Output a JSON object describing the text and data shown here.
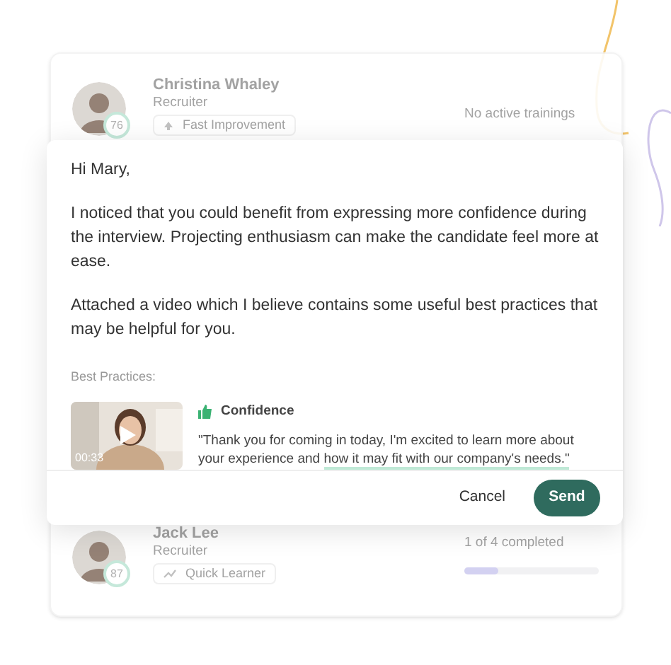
{
  "people": [
    {
      "name": "Christina Whaley",
      "role": "Recruiter",
      "score": "76",
      "tag": {
        "kind": "arrow",
        "label": "Fast Improvement"
      },
      "status": {
        "kind": "text",
        "label": "No active trainings"
      }
    },
    {
      "name": "Jack Lee",
      "role": "Recruiter",
      "score": "87",
      "tag": {
        "kind": "trend",
        "label": "Quick Learner"
      },
      "status": {
        "kind": "progress",
        "label": "1 of 4 completed",
        "level": 0.25
      }
    }
  ],
  "message": {
    "greeting": "Hi Mary,",
    "paragraphs": [
      "I noticed that you could benefit from expressing more confidence during the interview. Projecting enthusiasm can make the candidate feel more at ease.",
      "Attached a video which I believe contains some useful best practices that may be helpful for you."
    ],
    "best_practices_label": "Best Practices:",
    "video": {
      "duration": "00:33"
    },
    "skill": "Confidence",
    "quote_start": "\"Thank you for coming in today, I'm excited to learn more about your experience and ",
    "quote_highlight": "how it may fit with our company's needs.\"",
    "buttons": {
      "cancel": "Cancel",
      "send": "Send"
    }
  }
}
